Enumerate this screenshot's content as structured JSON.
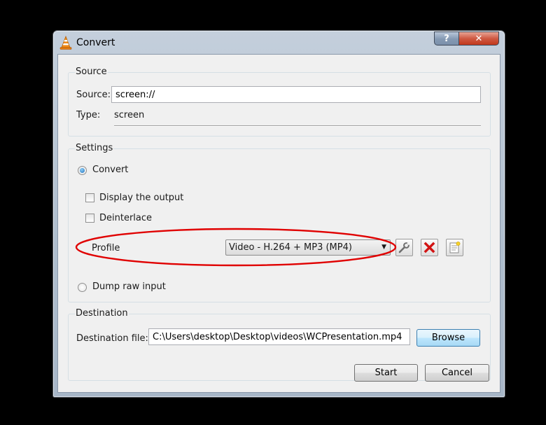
{
  "window": {
    "title": "Convert",
    "help_label": "?",
    "close_label": "✕"
  },
  "source": {
    "group_title": "Source",
    "source_label": "Source:",
    "source_value": "screen://",
    "type_label": "Type:",
    "type_value": "screen"
  },
  "settings": {
    "group_title": "Settings",
    "convert_label": "Convert",
    "convert_selected": true,
    "display_output_label": "Display the output",
    "deinterlace_label": "Deinterlace",
    "profile_label": "Profile",
    "profile_value": "Video - H.264 + MP3 (MP4)",
    "dump_raw_label": "Dump raw input"
  },
  "destination": {
    "group_title": "Destination",
    "file_label": "Destination file:",
    "file_value": "C:\\Users\\desktop\\Desktop\\videos\\WCPresentation.mp4",
    "browse_label": "Browse"
  },
  "actions": {
    "start_label": "Start",
    "cancel_label": "Cancel"
  },
  "icons": {
    "app": "vlc-cone-icon",
    "edit_profile": "wrench-icon",
    "delete_profile": "red-x-icon",
    "new_profile": "new-document-icon",
    "dropdown": "chevron-down-icon"
  },
  "colors": {
    "annotation_ring": "#e00000",
    "delete_icon": "#d21414",
    "default_button_border": "#3c7fb1"
  }
}
